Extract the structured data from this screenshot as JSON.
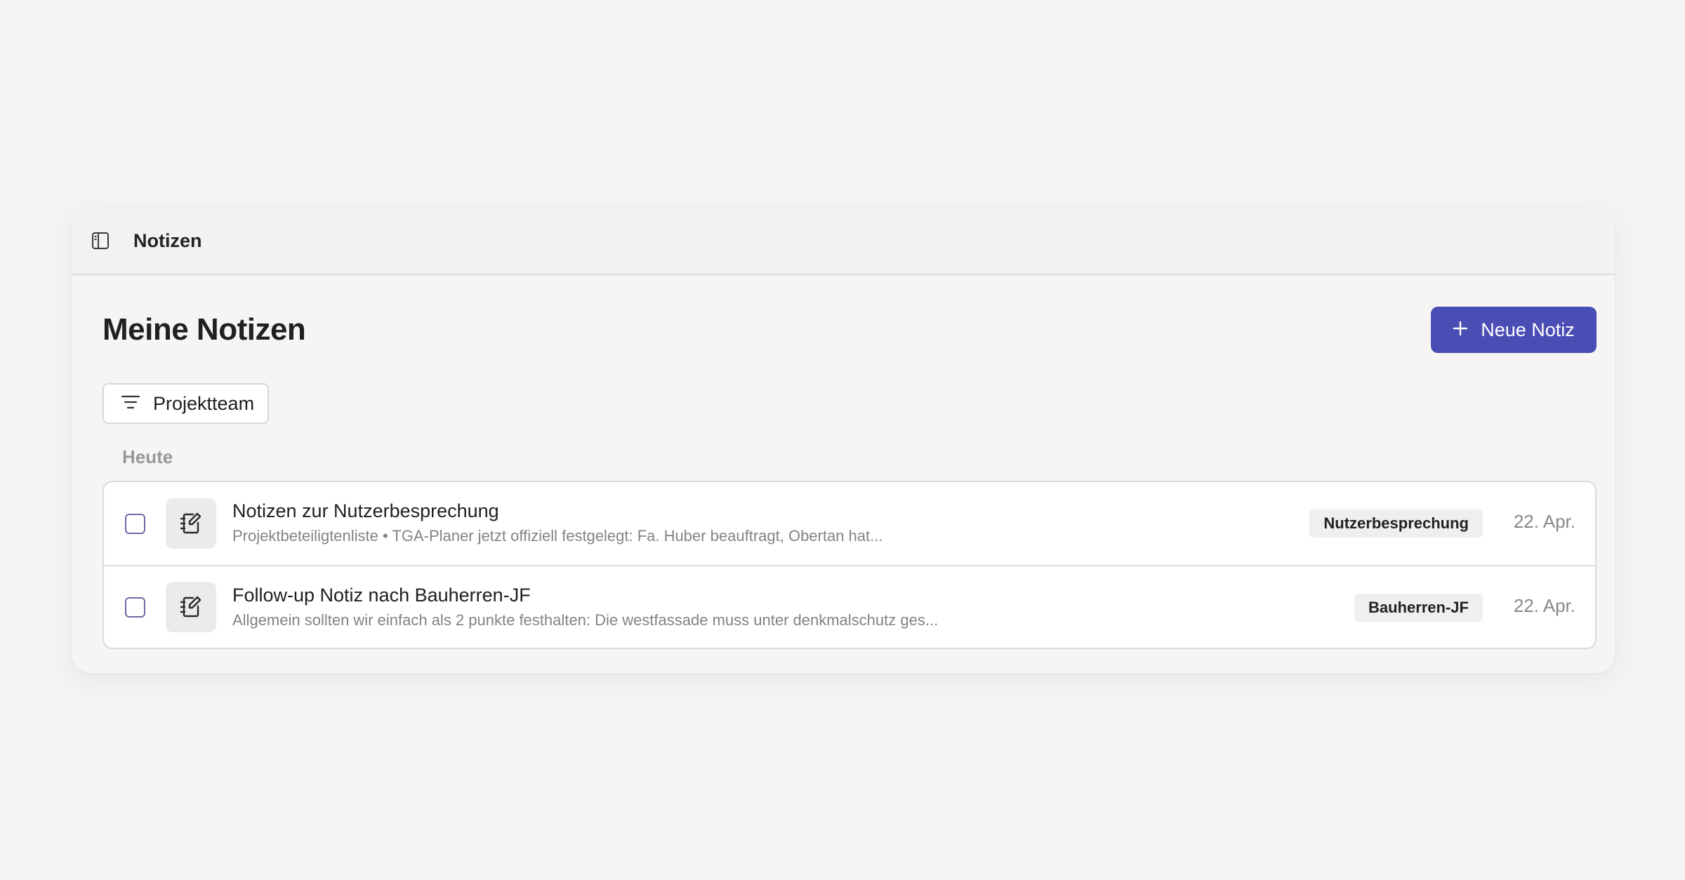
{
  "app": {
    "title": "Notizen"
  },
  "main": {
    "page_title": "Meine Notizen",
    "new_note_label": "Neue Notiz",
    "filter_label": "Projektteam",
    "section_label": "Heute"
  },
  "notes": [
    {
      "title": "Notizen zur Nutzerbesprechung",
      "snippet": "Projektbeteiligtenliste • TGA-Planer jetzt offiziell festgelegt: Fa. Huber beauftragt, Obertan hat...",
      "tag": "Nutzerbesprechung",
      "date": "22. Apr."
    },
    {
      "title": "Follow-up Notiz nach Bauherren-JF",
      "snippet": "Allgemein sollten wir einfach als 2 punkte festhalten: Die westfassade muss unter denkmalschutz ges...",
      "tag": "Bauherren-JF",
      "date": "22. Apr."
    }
  ],
  "icons": {
    "sidebar": "sidebar-toggle-icon",
    "plus": "plus-icon",
    "filter": "filter-icon",
    "note": "notebook-edit-icon"
  },
  "colors": {
    "accent": "#4a4db3",
    "background": "#f4f4f4",
    "window": "#f6f5f4",
    "checkbox_border": "#6e6aa8"
  }
}
